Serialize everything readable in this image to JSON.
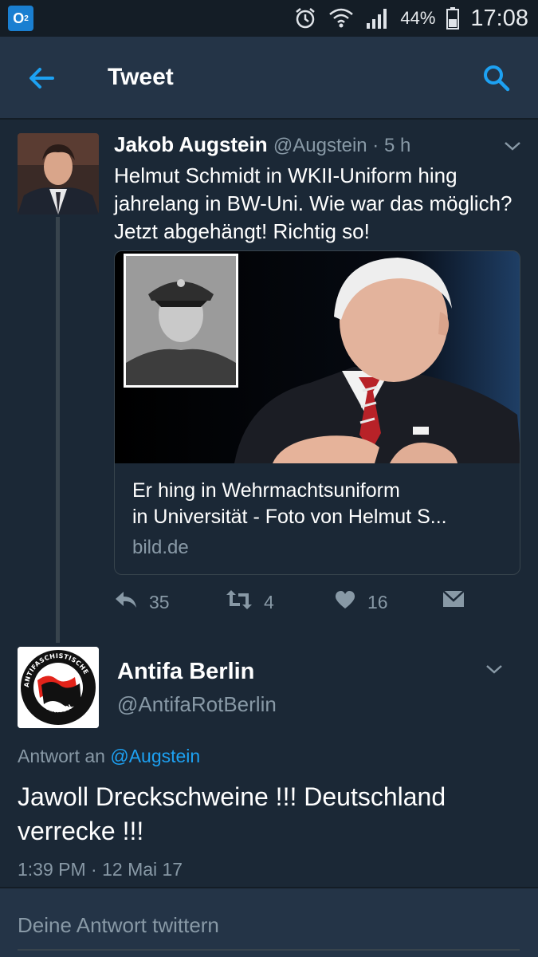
{
  "status_bar": {
    "carrier": "O",
    "carrier_sub": "2",
    "battery": "44%",
    "time": "17:08",
    "icons": [
      "alarm-icon",
      "wifi-icon",
      "signal-icon",
      "battery-icon"
    ]
  },
  "app_bar": {
    "title": "Tweet",
    "icons": [
      "back-arrow-icon",
      "search-icon"
    ]
  },
  "tweet": {
    "author_name": "Jakob Augstein",
    "author_handle": "@Augstein",
    "age": " · 5 h",
    "text": "Helmut Schmidt in WKII-Uniform hing jahrelang in BW-Uni. Wie war das möglich? Jetzt abgehängt! Richtig so!",
    "card": {
      "title_line1": "Er hing in Wehrmachtsuniform",
      "title_line2": "in Universität - Foto von Helmut S...",
      "domain": "bild.de"
    },
    "actions": {
      "replies": "35",
      "retweets": "4",
      "likes": "16"
    }
  },
  "reply": {
    "author_name": "Antifa Berlin",
    "author_handle": "@AntifaRotBerlin",
    "reply_prefix": "Antwort an ",
    "reply_to": "@Augstein",
    "text": "Jawoll Dreckschweine !!! Deutschland verrecke !!!",
    "timestamp": "1:39 PM · 12 Mai 17",
    "avatar_logo_text_top": "ANTIFASCHISTISCHE",
    "avatar_logo_text_bottom": "AKTION"
  },
  "compose": {
    "placeholder": "Deine Antwort twittern"
  },
  "colors": {
    "background": "#1b2836",
    "header": "#243447",
    "accent": "#1da1f2",
    "secondary_text": "#8899a6"
  }
}
